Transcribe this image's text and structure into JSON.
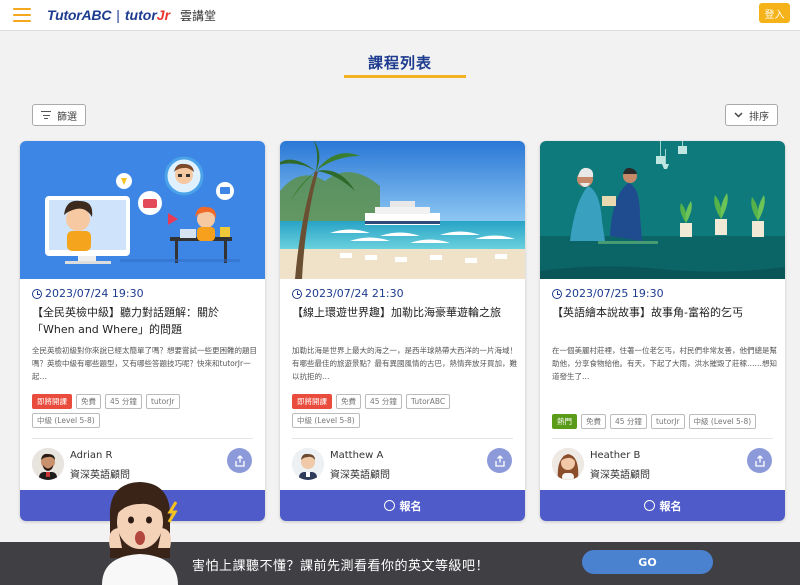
{
  "header": {
    "logo_abc": "TutorABC",
    "logo_sep": "|",
    "logo_jr_prefix": "tutor",
    "logo_jr_suffix": "Jr",
    "logo_cn": "雲講堂",
    "login_label": "登入"
  },
  "page": {
    "title": "課程列表",
    "filter_label": "篩選",
    "sort_label": "排序",
    "accent_color": "#4e5bc9",
    "title_color": "#1d3b8f",
    "highlight_color": "#f4b223"
  },
  "cards": [
    {
      "date": "2023/07/24 19:30",
      "title": "【全民英檢中級】聽力對話題解：關於「When and Where」的問題",
      "desc": "全民英檢初級對你來說已經太簡單了嗎？想要嘗試一些更困難的題目嗎？英檢中級有哪些題型，又有哪些答題技巧呢？快來和tutorJr一起…",
      "tags_row1": [
        {
          "label": "即將開課",
          "style": "red"
        },
        {
          "label": "免費",
          "style": ""
        },
        {
          "label": "45 分鐘",
          "style": ""
        },
        {
          "label": "tutorJr",
          "style": ""
        }
      ],
      "tags_row2": [
        {
          "label": "中級 (Level 5-8)",
          "style": ""
        }
      ],
      "teacher_name": "Adrian R",
      "teacher_role": "資深英語顧問",
      "enroll_label": "",
      "image": "kids-online-learning"
    },
    {
      "date": "2023/07/24 21:30",
      "title": "【線上環遊世界趣】加勒比海豪華遊輪之旅",
      "desc": "加勒比海是世界上最大的海之一，是西半球熱帶大西洋的一片海域！有哪些最佳的旅遊景點？最有異國風情的古巴，熱情奔放牙買加，難以抗拒的…",
      "tags_row1": [
        {
          "label": "即將開課",
          "style": "red"
        },
        {
          "label": "免費",
          "style": ""
        },
        {
          "label": "45 分鐘",
          "style": ""
        },
        {
          "label": "TutorABC",
          "style": ""
        }
      ],
      "tags_row2": [
        {
          "label": "中級 (Level 5-8)",
          "style": ""
        }
      ],
      "teacher_name": "Matthew A",
      "teacher_role": "資深英語顧問",
      "enroll_label": "報名",
      "image": "caribbean-beach-cruise"
    },
    {
      "date": "2023/07/25 19:30",
      "title": "【英語繪本說故事】故事角-富裕的乞丐",
      "desc": "在一個美麗村莊裡，住著一位老乞丐，村民們非常友善，他們總是幫助他，分享食物給他。有天，下起了大雨，洪水摧毀了莊稼……想知道發生了…",
      "tags_row1": [
        {
          "label": "熱門",
          "style": "green"
        },
        {
          "label": "免費",
          "style": ""
        },
        {
          "label": "45 分鐘",
          "style": ""
        },
        {
          "label": "tutorJr",
          "style": ""
        },
        {
          "label": "中級 (Level 5-8)",
          "style": ""
        }
      ],
      "tags_row2": [],
      "teacher_name": "Heather B",
      "teacher_role": "資深英語顧問",
      "enroll_label": "報名",
      "image": "storybook-beggar-illustration"
    }
  ],
  "banner": {
    "text": "害怕上課聽不懂？課前先測看看你的英文等級吧！",
    "go_label": "GO"
  }
}
